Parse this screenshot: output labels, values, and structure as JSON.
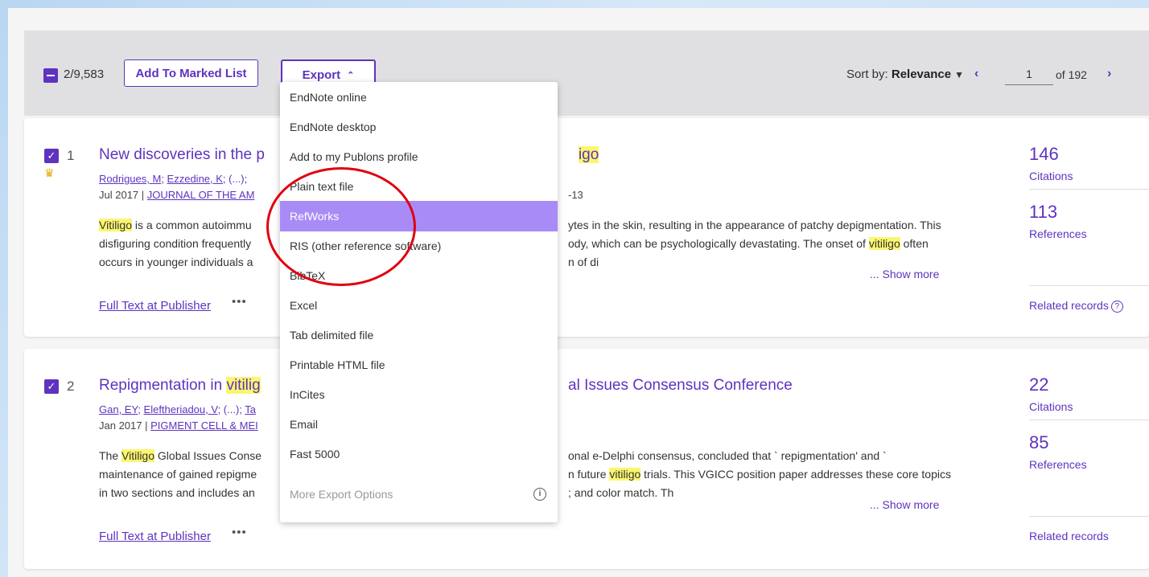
{
  "toolbar": {
    "selected_count": "2/9,583",
    "add_to_marked_list": "Add To Marked List",
    "export_label": "Export",
    "sort_prefix": "Sort by:",
    "sort_value": "Relevance",
    "page_value": "1",
    "of_pages": "of 192"
  },
  "export_menu": {
    "items": [
      "EndNote online",
      "EndNote desktop",
      "Add to my Publons profile",
      "Plain text file",
      "RefWorks",
      "RIS (other reference software)",
      "BibTeX",
      "Excel",
      "Tab delimited file",
      "Printable HTML file",
      "InCites",
      "Email",
      "Fast 5000",
      "More Export Options"
    ],
    "active_item": "RefWorks",
    "disabled_item": "More Export Options"
  },
  "annotation": {
    "color": "#e00010"
  },
  "records": [
    {
      "number": "1",
      "title_pre": "New discoveries in the p",
      "title_hl": "igo",
      "authors": [
        "Rodrigues, M",
        "Ezzedine, K"
      ],
      "authors_tail": "; (...); ",
      "meta_date": "Jul 2017 | ",
      "meta_journal": "JOURNAL OF THE AM",
      "meta_tail": "-13",
      "abstract": [
        {
          "hl": "Vitiligo",
          "text": " is a common autoimmu",
          "right": "ytes in the skin, resulting in the appearance of patchy depigmentation. This"
        },
        {
          "text": "disfiguring condition frequently",
          "right": "ody, which can be psychologically devastating. The onset of ",
          "right_hl": "vitiligo",
          "right_tail": " often"
        },
        {
          "text": "occurs in younger individuals a",
          "right": "n of di"
        }
      ],
      "show_more": "... Show more",
      "full_text": "Full Text at Publisher",
      "citations": "146",
      "citations_label": "Citations",
      "references": "113",
      "references_label": "References",
      "related": "Related records"
    },
    {
      "number": "2",
      "title_pre": "Repigmentation in ",
      "title_hl": "vitilig",
      "title_tail": "al Issues Consensus Conference",
      "authors": [
        "Gan, EY",
        "Eleftheriadou, V"
      ],
      "authors_tail": "; (...); ",
      "authors_cut": "Ta",
      "meta_date": "Jan 2017 | ",
      "meta_journal": "PIGMENT CELL & MEI",
      "abstract": [
        {
          "text": "The ",
          "hl": "Vitiligo",
          "text2": " Global Issues Conse",
          "right": "onal e-Delphi consensus, concluded that ` repigmentation' and `"
        },
        {
          "text": "maintenance of gained repigme",
          "right": "n future ",
          "right_hl": "vitiligo",
          "right_tail": " trials. This VGICC position paper addresses these core topics"
        },
        {
          "text": "in two sections and includes an",
          "right": "; and color match. Th"
        }
      ],
      "show_more": "... Show more",
      "full_text": "Full Text at Publisher",
      "citations": "22",
      "citations_label": "Citations",
      "references": "85",
      "references_label": "References",
      "related": "Related records"
    }
  ]
}
